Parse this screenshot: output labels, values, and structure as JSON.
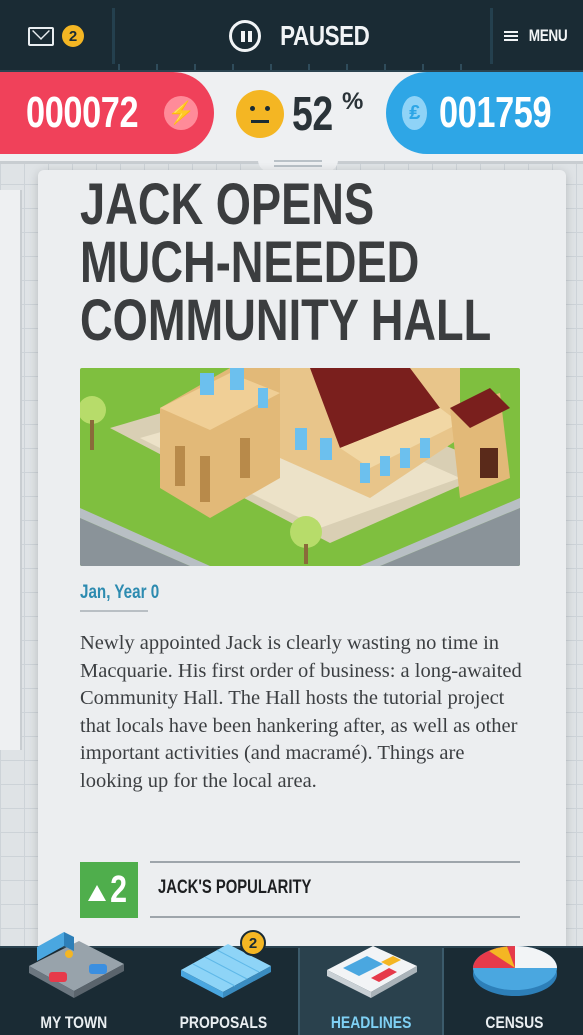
{
  "topbar": {
    "mail_count": "2",
    "paused_label": "PAUSED",
    "menu_label": "MENU"
  },
  "stats": {
    "score": "000072",
    "approval": "52",
    "approval_unit": "%",
    "funds": "001759"
  },
  "article": {
    "headline": "JACK OPENS MUCH-NEEDED COMMUNITY HALL",
    "date": "Jan, Year 0",
    "body": "Newly appointed Jack is clearly wasting no time in Macquarie. His first order of business: a long-awaited Community Hall. The Hall hosts the tutorial project that locals have been hankering after, as well as other important activities (and macramé). Things are looking up for the local area.",
    "effect": {
      "value": "2",
      "label": "JACK'S POPULARITY",
      "direction": "up",
      "color": "#4fae4c"
    }
  },
  "nav": {
    "items": [
      {
        "label": "MY TOWN",
        "icon": "town-icon",
        "active": false
      },
      {
        "label": "PROPOSALS",
        "icon": "proposals-icon",
        "active": false,
        "badge": "2"
      },
      {
        "label": "HEADLINES",
        "icon": "newspaper-icon",
        "active": true
      },
      {
        "label": "CENSUS",
        "icon": "pie-chart-icon",
        "active": false
      }
    ]
  },
  "colors": {
    "score_red": "#f0415a",
    "funds_blue": "#2ea6e6",
    "mood_yellow": "#f4b623",
    "bar_dark": "#1a2b34",
    "date_blue": "#2d8bb0"
  }
}
